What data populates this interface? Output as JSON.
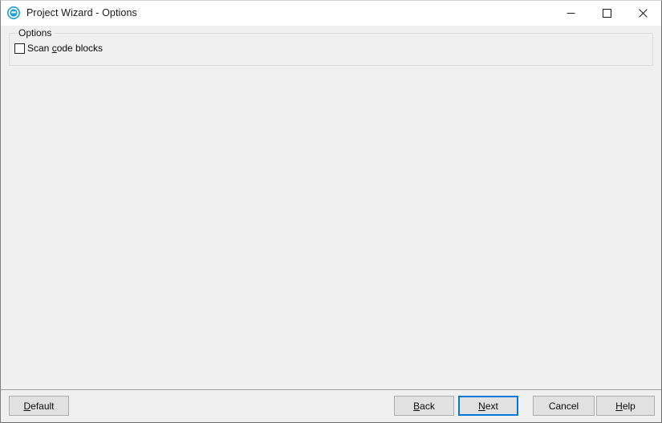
{
  "window": {
    "title": "Project Wizard - Options",
    "icon": "codeblocks-app-icon",
    "accent_color": "#0078d7",
    "titlebar_background": "#ffffff",
    "body_background": "#f0f0f0",
    "controls": {
      "minimize": "minimize-icon",
      "maximize": "maximize-icon",
      "close": "close-icon"
    }
  },
  "options_group": {
    "legend": "Options",
    "checkboxes": [
      {
        "label_before": "Scan ",
        "mnemonic": "c",
        "label_after": "ode blocks",
        "full_label": "Scan code blocks",
        "checked": false
      }
    ]
  },
  "footer": {
    "default": {
      "before": "",
      "mnemonic": "D",
      "after": "efault",
      "full_label": "Default"
    },
    "back": {
      "before": "",
      "mnemonic": "B",
      "after": "ack",
      "full_label": "Back"
    },
    "next": {
      "before": "",
      "mnemonic": "N",
      "after": "ext",
      "full_label": "Next",
      "focused": true
    },
    "cancel": {
      "before": "Cancel",
      "mnemonic": "",
      "after": "",
      "full_label": "Cancel"
    },
    "help": {
      "before": "",
      "mnemonic": "H",
      "after": "elp",
      "full_label": "Help"
    }
  }
}
